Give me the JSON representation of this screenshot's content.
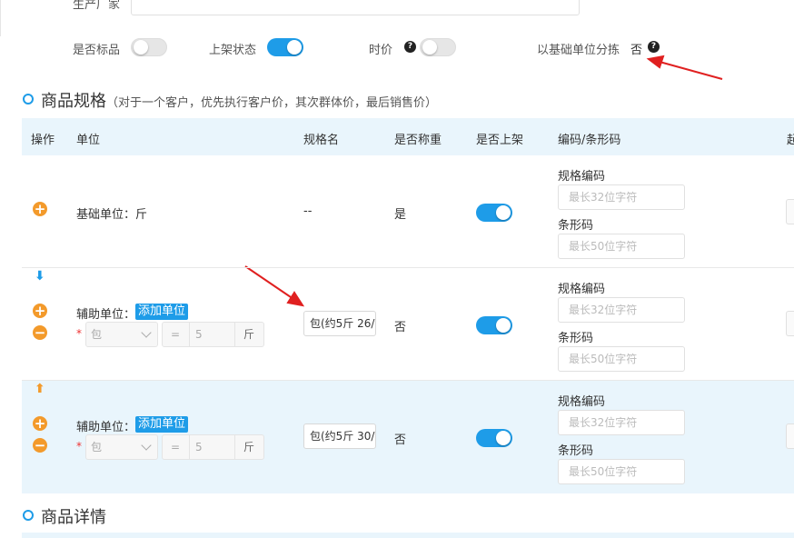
{
  "top": {
    "origin_label": "生产厂家",
    "standard_label": "是否标品",
    "listing_label": "上架状态",
    "price_label": "时价",
    "sort_label": "以基础单位分拣",
    "sort_value": "否"
  },
  "specs": {
    "title": "商品规格",
    "subtitle": "（对于一个客户，优先执行客户价，其次群体价，最后销售价）",
    "headers": [
      "操作",
      "单位",
      "规格名",
      "是否称重",
      "是否上架",
      "编码/条形码",
      "起"
    ],
    "rows": [
      {
        "unit_text": "基础单位：斤",
        "spec_name": "--",
        "weighted": "是",
        "code_label": "规格编码",
        "code_placeholder": "最长32位字符",
        "barcode_label": "条形码",
        "barcode_placeholder": "最长50位字符"
      },
      {
        "unit_label": "辅助单位：",
        "add_unit": "添加单位",
        "required": "*",
        "unit_select": "包",
        "eq": "=",
        "qty": "5",
        "base_unit": "斤",
        "spec_name": "包(约5斤 26/",
        "weighted": "否",
        "code_label": "规格编码",
        "code_placeholder": "最长32位字符",
        "barcode_label": "条形码",
        "barcode_placeholder": "最长50位字符"
      },
      {
        "unit_label": "辅助单位：",
        "add_unit": "添加单位",
        "required": "*",
        "unit_select": "包",
        "eq": "=",
        "qty": "5",
        "base_unit": "斤",
        "spec_name": "包(约5斤 30/",
        "weighted": "否",
        "code_label": "规格编码",
        "code_placeholder": "最长32位字符",
        "barcode_label": "条形码",
        "barcode_placeholder": "最长50位字符"
      }
    ]
  },
  "details": {
    "title": "商品详情"
  },
  "icons": {
    "help": "?",
    "plus": "+",
    "minus": "−",
    "down": "⬇",
    "up": "⬆"
  },
  "colors": {
    "accent": "#1e9ce8",
    "orange": "#f39a2b",
    "annotation": "#e02020"
  }
}
